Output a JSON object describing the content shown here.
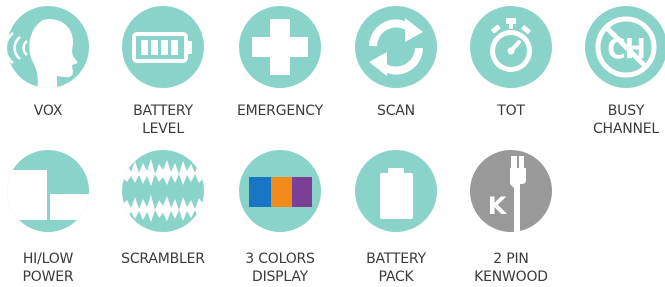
{
  "colors": {
    "teal": "#8ad3c8",
    "gray": "#999999",
    "label": "#3b3b3b",
    "blue": "#1976c4",
    "orange": "#f08a1b",
    "purple": "#7b3f97"
  },
  "features": [
    {
      "icon": "vox-head-icon",
      "label": [
        "VOX"
      ]
    },
    {
      "icon": "battery-level-icon",
      "label": [
        "BATTERY",
        "LEVEL"
      ]
    },
    {
      "icon": "emergency-cross-icon",
      "label": [
        "EMERGENCY"
      ]
    },
    {
      "icon": "scan-arrows-icon",
      "label": [
        "SCAN"
      ]
    },
    {
      "icon": "stopwatch-icon",
      "label": [
        "TOT"
      ]
    },
    {
      "icon": "busy-channel-icon",
      "icon_text": "CH",
      "label": [
        "BUSY",
        "CHANNEL"
      ]
    },
    {
      "icon": "hi-low-power-icon",
      "label": [
        "HI/LOW",
        "POWER"
      ]
    },
    {
      "icon": "scrambler-wave-icon",
      "label": [
        "SCRAMBLER"
      ]
    },
    {
      "icon": "color-display-icon",
      "label": [
        "3 COLORS",
        "DISPLAY"
      ]
    },
    {
      "icon": "battery-pack-icon",
      "label": [
        "BATTERY",
        "PACK"
      ]
    },
    {
      "icon": "kenwood-plug-icon",
      "icon_text": "K",
      "label": [
        "2 PIN",
        "KENWOOD"
      ]
    }
  ]
}
